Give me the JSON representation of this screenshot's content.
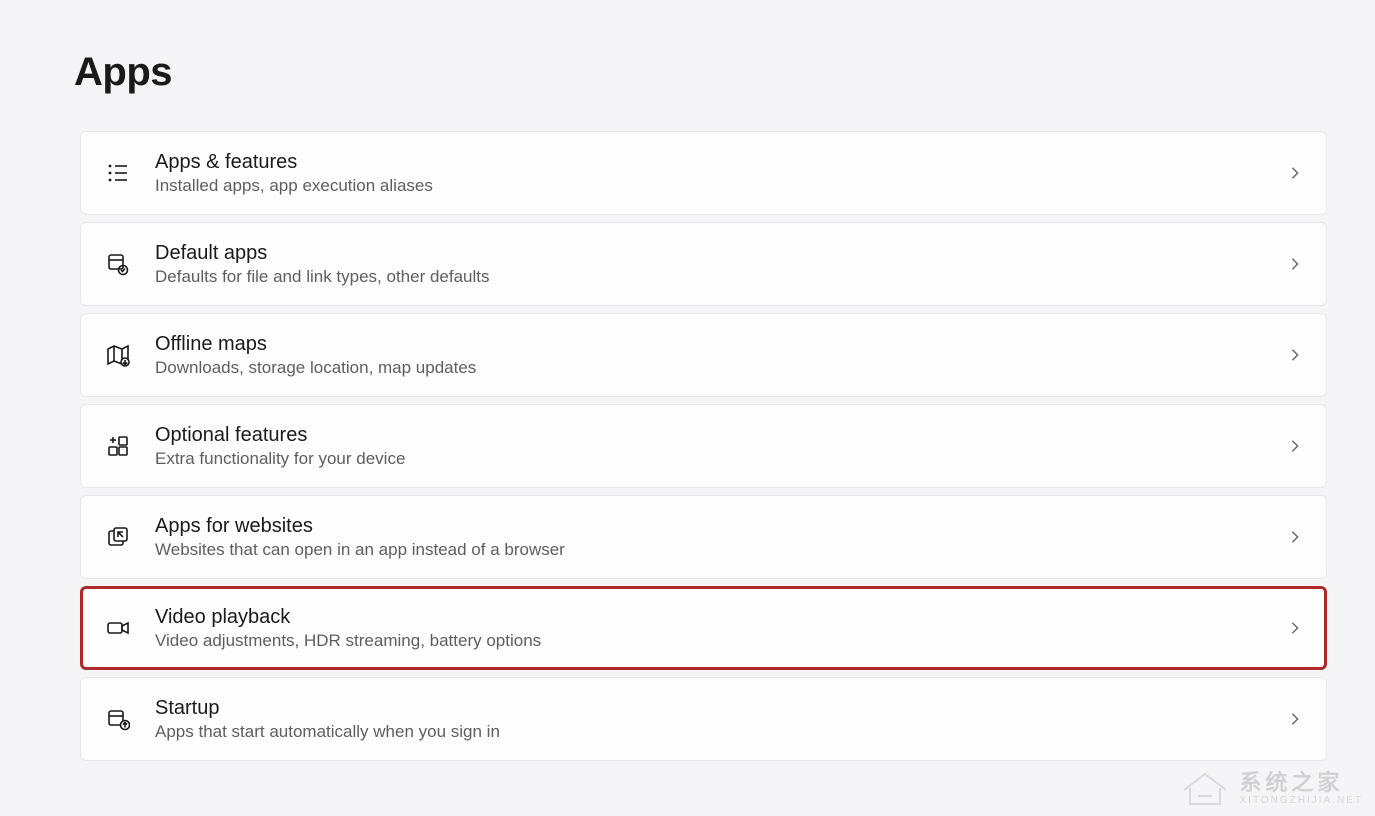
{
  "page": {
    "title": "Apps"
  },
  "items": [
    {
      "title": "Apps & features",
      "subtitle": "Installed apps, app execution aliases"
    },
    {
      "title": "Default apps",
      "subtitle": "Defaults for file and link types, other defaults"
    },
    {
      "title": "Offline maps",
      "subtitle": "Downloads, storage location, map updates"
    },
    {
      "title": "Optional features",
      "subtitle": "Extra functionality for your device"
    },
    {
      "title": "Apps for websites",
      "subtitle": "Websites that can open in an app instead of a browser"
    },
    {
      "title": "Video playback",
      "subtitle": "Video adjustments, HDR streaming, battery options"
    },
    {
      "title": "Startup",
      "subtitle": "Apps that start automatically when you sign in"
    }
  ],
  "watermark": {
    "main": "系统之家",
    "sub": "XITONGZHIJIA.NET"
  }
}
